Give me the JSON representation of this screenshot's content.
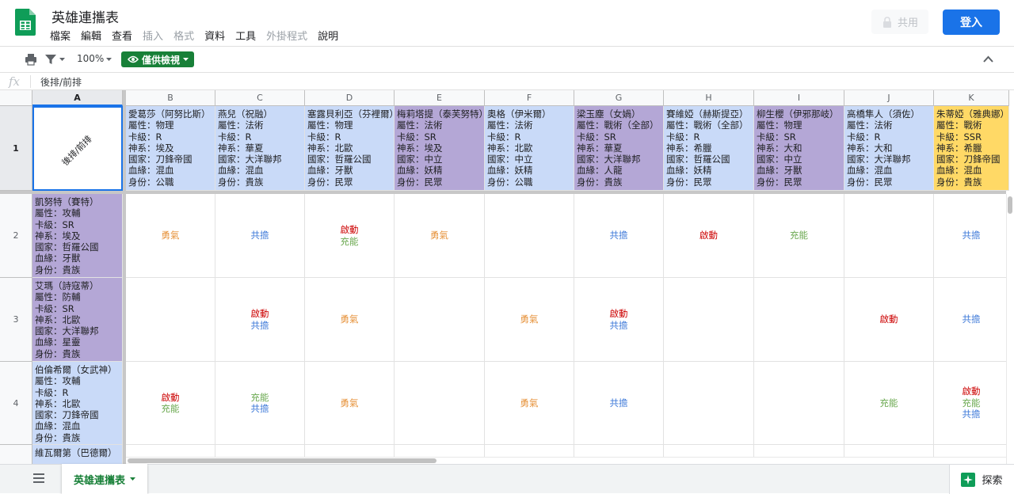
{
  "header": {
    "title": "英雄連攜表",
    "menu": [
      {
        "label": "檔案",
        "enabled": true
      },
      {
        "label": "編輯",
        "enabled": true
      },
      {
        "label": "查看",
        "enabled": true
      },
      {
        "label": "插入",
        "enabled": false
      },
      {
        "label": "格式",
        "enabled": false
      },
      {
        "label": "資料",
        "enabled": true
      },
      {
        "label": "工具",
        "enabled": true
      },
      {
        "label": "外掛程式",
        "enabled": false
      },
      {
        "label": "說明",
        "enabled": true
      }
    ],
    "share_label": "共用",
    "login_label": "登入"
  },
  "toolbar": {
    "zoom": "100%",
    "view_mode_label": "僅供檢視",
    "icons": [
      "print-icon",
      "filter-icon",
      "eye-icon",
      "collapse-icon"
    ]
  },
  "formula_bar": {
    "fx": "fx",
    "value": "後排/前排"
  },
  "grid": {
    "columns": [
      "A",
      "B",
      "C",
      "D",
      "E",
      "F",
      "G",
      "H",
      "I",
      "J",
      "K"
    ],
    "rows": [
      "1",
      "2",
      "3",
      "4"
    ],
    "selected_col": "A",
    "selected_row": "1",
    "a1": "後排/前排",
    "col_heroes": [
      {
        "col": "B",
        "color": "#c9daf8",
        "lines": [
          "愛葛莎（阿努比斯）",
          "屬性：物理",
          "卡級：R",
          "神系：埃及",
          "國家：刀鋒帝國",
          "血緣：混血",
          "身份：公職"
        ]
      },
      {
        "col": "C",
        "color": "#c9daf8",
        "lines": [
          "燕兒（祝融）",
          "屬性：法術",
          "卡級：R",
          "神系：華夏",
          "國家：大洋聯邦",
          "血緣：混血",
          "身份：貴族"
        ]
      },
      {
        "col": "D",
        "color": "#c9daf8",
        "lines": [
          "塞露貝利亞（芬裡爾）",
          "屬性：物理",
          "卡級：R",
          "神系：北歐",
          "國家：哲羅公國",
          "血緣：牙獸",
          "身份：民眾"
        ]
      },
      {
        "col": "E",
        "color": "#b4a7d6",
        "lines": [
          "梅莉塔提（泰芙努特）",
          "屬性：法術",
          "卡級：SR",
          "神系：埃及",
          "國家：中立",
          "血緣：妖精",
          "身份：民眾"
        ]
      },
      {
        "col": "F",
        "color": "#c9daf8",
        "lines": [
          "奧格（伊米爾）",
          "屬性：法術",
          "卡級：R",
          "神系：北歐",
          "國家：中立",
          "血緣：妖精",
          "身份：公職"
        ]
      },
      {
        "col": "G",
        "color": "#b4a7d6",
        "lines": [
          "梁玉塵（女媧）",
          "屬性：戰術（全部）",
          "卡級：SR",
          "神系：華夏",
          "國家：大洋聯邦",
          "血緣：人龍",
          "身份：貴族"
        ]
      },
      {
        "col": "H",
        "color": "#c9daf8",
        "lines": [
          "賽維婭（赫斯提亞）",
          "屬性：戰術（全部）",
          "卡級：R",
          "神系：希臘",
          "國家：哲羅公國",
          "血緣：妖精",
          "身份：民眾"
        ]
      },
      {
        "col": "I",
        "color": "#b4a7d6",
        "lines": [
          "柳生櫻（伊邪那岐）",
          "屬性：物理",
          "卡級：SR",
          "神系：大和",
          "國家：中立",
          "血緣：牙獸",
          "身份：民眾"
        ]
      },
      {
        "col": "J",
        "color": "#c9daf8",
        "lines": [
          "高橋隼人（須佐）",
          "屬性：法術",
          "卡級：R",
          "神系：大和",
          "國家：大洋聯邦",
          "血緣：混血",
          "身份：民眾"
        ]
      },
      {
        "col": "K",
        "color": "#ffd966",
        "lines": [
          "朱蒂婭（雅典娜）",
          "屬性：戰術",
          "卡級：SSR",
          "神系：希臘",
          "國家：刀鋒帝國",
          "血緣：混血",
          "身份：貴族"
        ]
      }
    ],
    "row_heroes": [
      {
        "row": "2",
        "color": "#b4a7d6",
        "lines": [
          "凱努特（賽特）",
          "屬性：攻輔",
          "卡級：SR",
          "神系：埃及",
          "國家：哲羅公國",
          "血緣：牙獸",
          "身份：貴族"
        ]
      },
      {
        "row": "3",
        "color": "#b4a7d6",
        "lines": [
          "艾瑪（詩寇蒂）",
          "屬性：防輔",
          "卡級：SR",
          "神系：北歐",
          "國家：大洋聯邦",
          "血緣：星靈",
          "身份：貴族"
        ]
      },
      {
        "row": "4",
        "color": "#c9daf8",
        "lines": [
          "伯倫希爾（女武神）",
          "屬性：攻輔",
          "卡級：R",
          "神系：北歐",
          "國家：刀鋒帝國",
          "血緣：混血",
          "身份：貴族"
        ]
      },
      {
        "row": "5",
        "color": "#c9daf8",
        "lines": [
          "維瓦爾第（巴德爾）"
        ]
      }
    ],
    "cells": [
      [
        [
          "勇氣"
        ],
        [
          "共擔"
        ],
        [
          "啟動",
          "充能"
        ],
        [
          "勇氣"
        ],
        [],
        [
          "共擔"
        ],
        [
          "啟動"
        ],
        [
          "充能"
        ],
        [],
        [
          "共擔"
        ]
      ],
      [
        [],
        [
          "啟動",
          "共擔"
        ],
        [
          "勇氣"
        ],
        [],
        [
          "勇氣"
        ],
        [
          "啟動",
          "共擔"
        ],
        [],
        [],
        [
          "啟動"
        ],
        [
          "共擔"
        ]
      ],
      [
        [
          "啟動",
          "充能"
        ],
        [
          "充能",
          "共擔"
        ],
        [
          "勇氣"
        ],
        [],
        [
          "勇氣"
        ],
        [
          "共擔"
        ],
        [],
        [],
        [
          "充能"
        ],
        [
          "啟動",
          "充能",
          "共擔"
        ]
      ]
    ],
    "tag_colors": {
      "勇氣": "#e69138",
      "共擔": "#3c78d8",
      "啟動": "#cc0000",
      "充能": "#6aa84f"
    }
  },
  "bottom": {
    "sheet_tab": "英雄連攜表",
    "explore_label": "探索"
  }
}
